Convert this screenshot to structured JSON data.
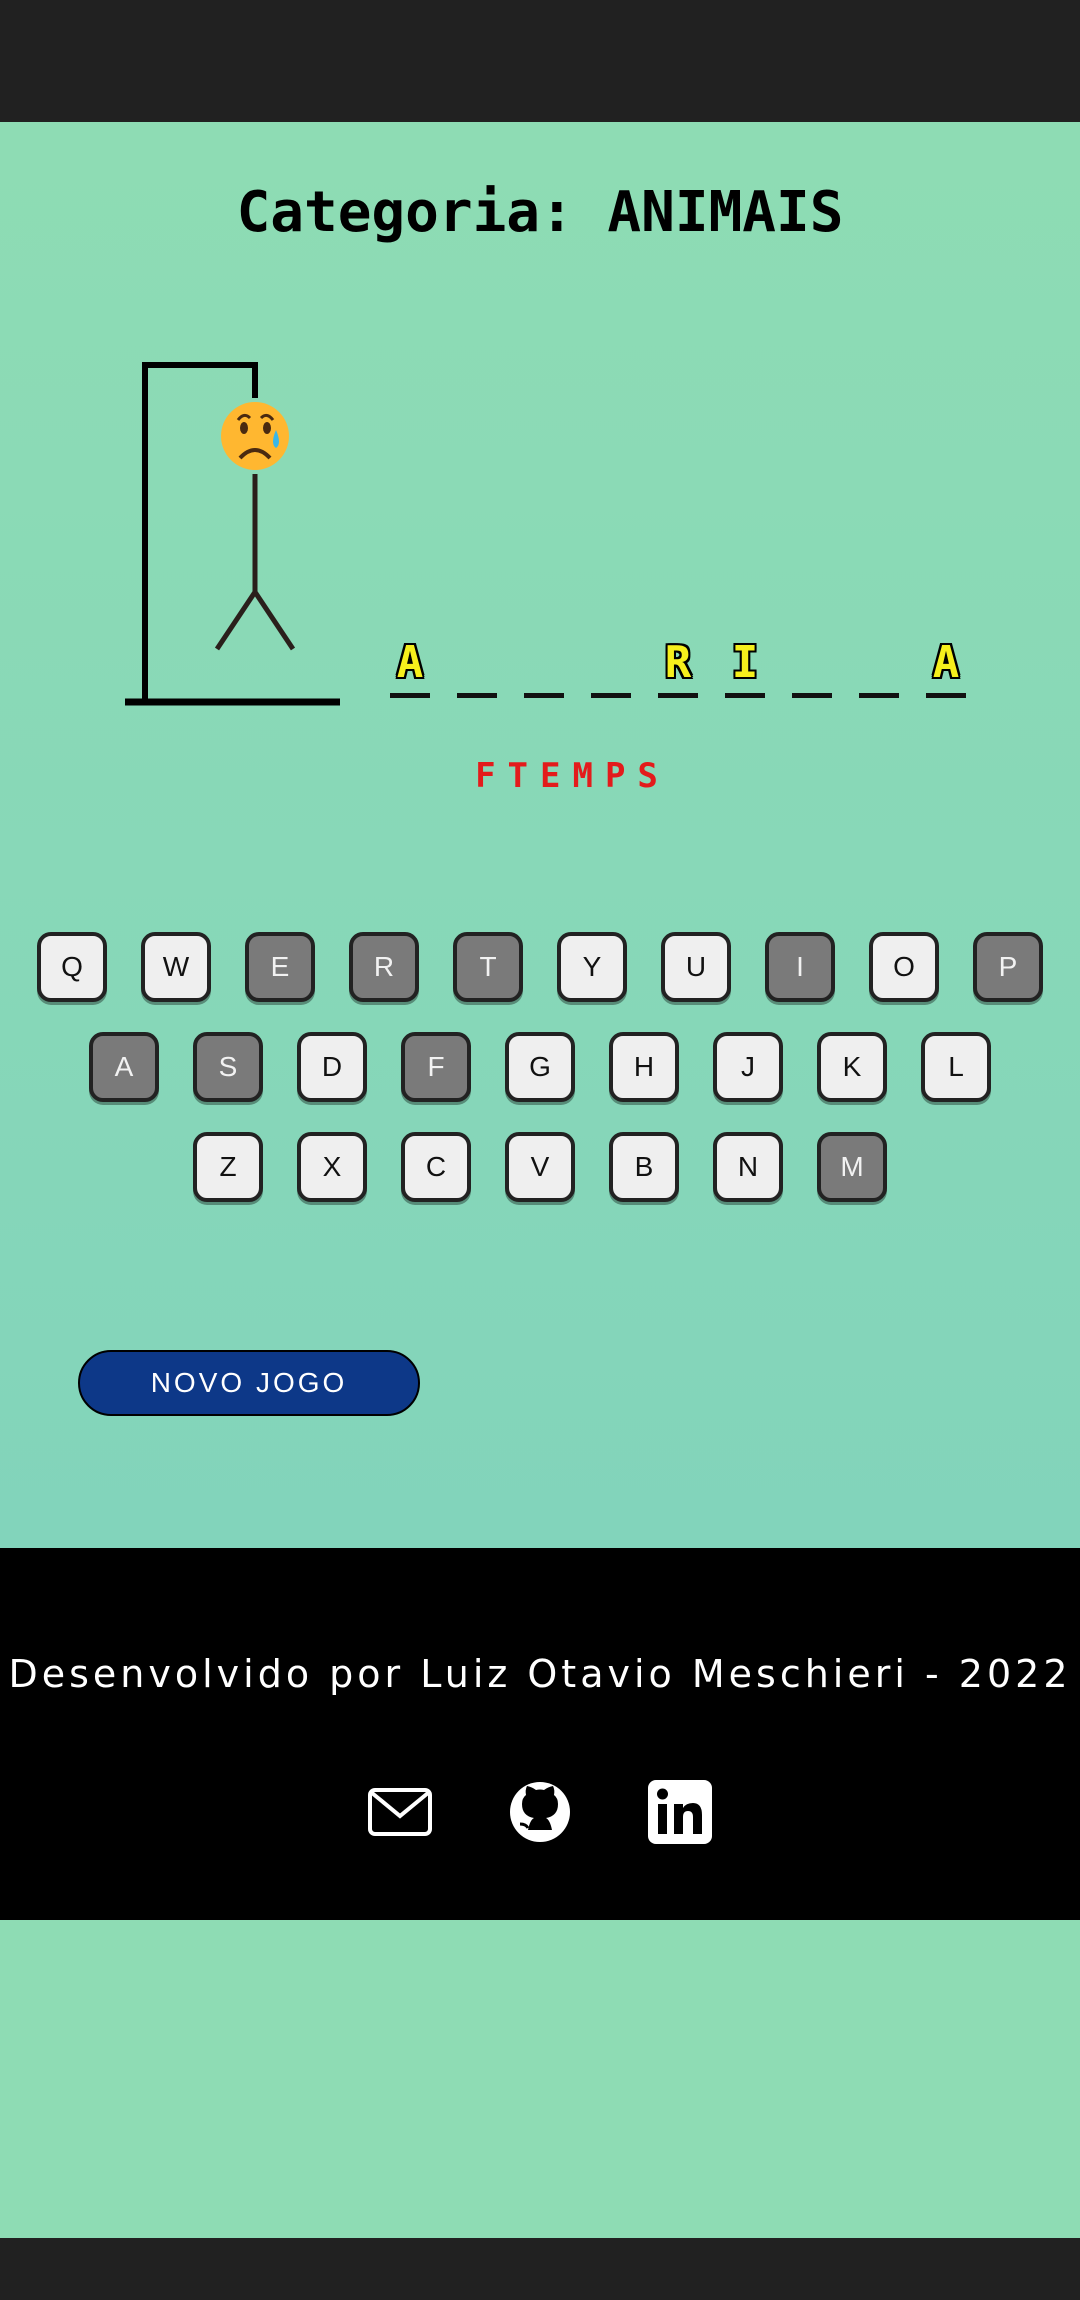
{
  "game": {
    "category_label": "Categoria: ANIMAIS",
    "word_letters": [
      "A",
      "",
      "",
      "",
      "R",
      "I",
      "",
      "",
      "A"
    ],
    "wrong_letters": "FTEMPS",
    "new_game_label": "NOVO JOGO",
    "lives_face_icon": "crying-face-icon"
  },
  "keyboard": {
    "rows": [
      [
        {
          "label": "Q",
          "used": false
        },
        {
          "label": "W",
          "used": false
        },
        {
          "label": "E",
          "used": true
        },
        {
          "label": "R",
          "used": true
        },
        {
          "label": "T",
          "used": true
        },
        {
          "label": "Y",
          "used": false
        },
        {
          "label": "U",
          "used": false
        },
        {
          "label": "I",
          "used": true
        },
        {
          "label": "O",
          "used": false
        },
        {
          "label": "P",
          "used": true
        }
      ],
      [
        {
          "label": "A",
          "used": true
        },
        {
          "label": "S",
          "used": true
        },
        {
          "label": "D",
          "used": false
        },
        {
          "label": "F",
          "used": true
        },
        {
          "label": "G",
          "used": false
        },
        {
          "label": "H",
          "used": false
        },
        {
          "label": "J",
          "used": false
        },
        {
          "label": "K",
          "used": false
        },
        {
          "label": "L",
          "used": false
        }
      ],
      [
        {
          "label": "Z",
          "used": false
        },
        {
          "label": "X",
          "used": false
        },
        {
          "label": "C",
          "used": false
        },
        {
          "label": "V",
          "used": false
        },
        {
          "label": "B",
          "used": false
        },
        {
          "label": "N",
          "used": false
        },
        {
          "label": "M",
          "used": true
        }
      ]
    ]
  },
  "footer": {
    "credit": "Desenvolvido por Luiz Otavio Meschieri - 2022",
    "links": [
      {
        "name": "email-icon"
      },
      {
        "name": "github-icon"
      },
      {
        "name": "linkedin-icon"
      }
    ]
  },
  "colors": {
    "background": "#8edcb4",
    "key_used": "#7a7a7a",
    "key_unused": "#efefef",
    "new_game_button": "#0d3888",
    "revealed_letter": "#f6ef1c",
    "wrong_letters": "#e31b1b"
  }
}
